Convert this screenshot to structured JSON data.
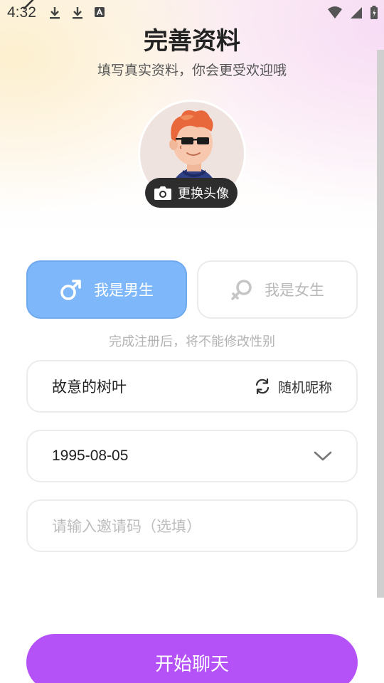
{
  "status_bar": {
    "time": "4:32",
    "left_icons": [
      "download-icon",
      "download-icon",
      "font-icon"
    ],
    "right_icons": [
      "wifi-icon",
      "signal-icon",
      "battery-icon"
    ]
  },
  "header": {
    "title": "完善资料",
    "subtitle": "填写真实资料，你会更受欢迎哦"
  },
  "avatar": {
    "change_label": "更换头像"
  },
  "gender": {
    "male_label": "我是男生",
    "female_label": "我是女生",
    "selected": "male",
    "hint": "完成注册后，将不能修改性别"
  },
  "form": {
    "nickname_value": "故意的树叶",
    "random_nickname_label": "随机昵称",
    "birthday_value": "1995-08-05",
    "invite_placeholder": "请输入邀请码（选填）"
  },
  "actions": {
    "start_label": "开始聊天"
  },
  "colors": {
    "male_selected": "#7eb8fb",
    "start_button": "#b452f7"
  }
}
